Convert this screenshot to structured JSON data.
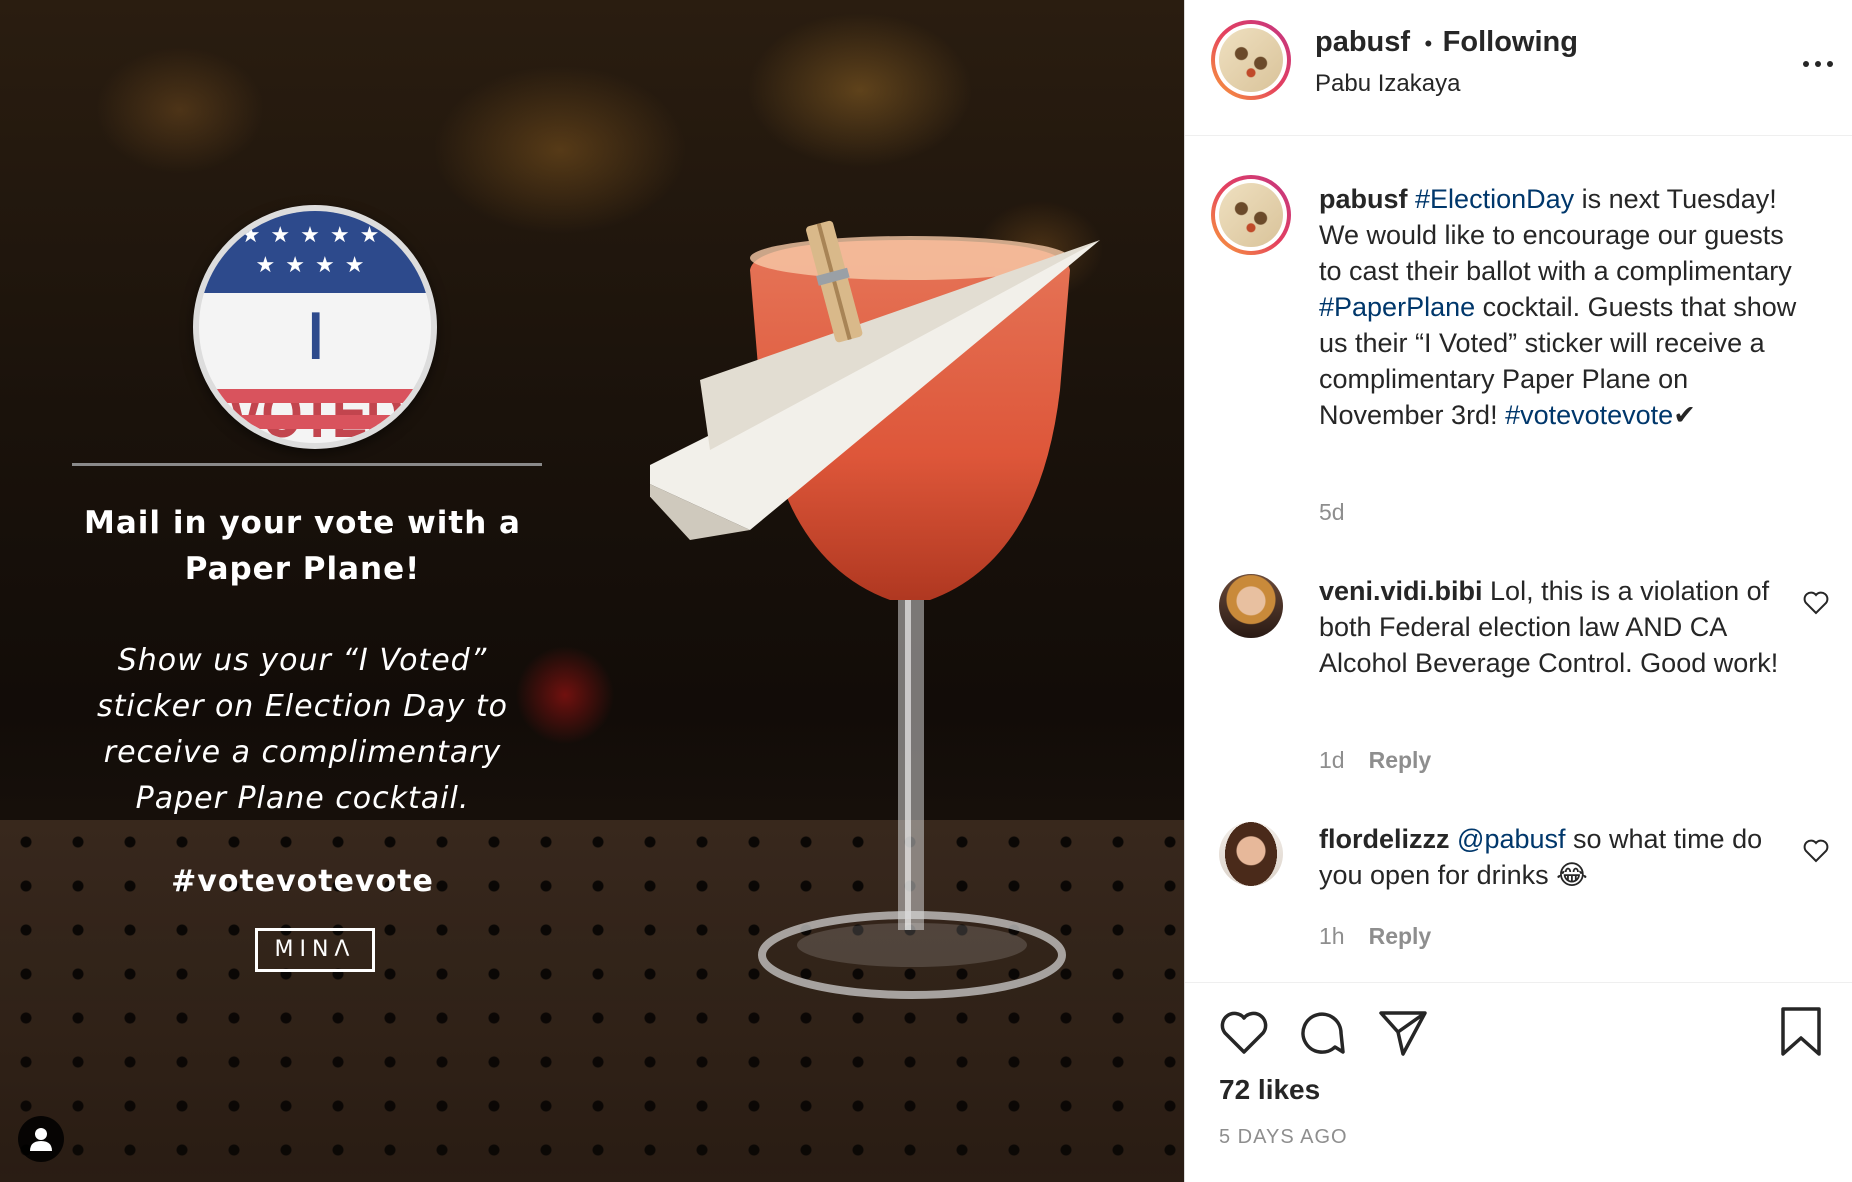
{
  "post_image": {
    "sticker_text": "I VOTED",
    "headline": "Mail in your vote with a Paper Plane!",
    "body": "Show us your “I Voted” sticker on Election Day to receive a complimentary Paper Plane cocktail.",
    "hashtag": "#votevotevote",
    "logo": "MINΛ"
  },
  "header": {
    "username": "pabusf",
    "separator": "•",
    "following_label": "Following",
    "location": "Pabu Izakaya"
  },
  "caption": {
    "username": "pabusf",
    "tag1": "#ElectionDay",
    "text1": " is next Tuesday! We would like to encourage our guests to cast their ballot with a complimentary ",
    "tag2": "#PaperPlane",
    "text2": " cocktail. Guests that show us their “I Voted” sticker will receive a complimentary Paper Plane on November 3rd! ",
    "tag3": "#votevotevote",
    "emoji": "✔",
    "age": "5d"
  },
  "comments": [
    {
      "username": "veni.vidi.bibi",
      "text": " Lol, this is a violation of both Federal election law AND CA Alcohol Beverage Control. Good work!",
      "age": "1d",
      "reply_label": "Reply"
    },
    {
      "username": "flordelizzz",
      "mention": "@pabusf",
      "text": " so what time do you open for drinks ",
      "emoji": "😂",
      "age": "1h",
      "reply_label": "Reply"
    }
  ],
  "footer": {
    "likes": "72 likes",
    "posted": "5 DAYS AGO"
  },
  "colors": {
    "link": "#00376b",
    "muted": "#8e8e8e",
    "text": "#262626"
  },
  "icons": [
    "heart-icon",
    "comment-icon",
    "share-icon",
    "bookmark-icon",
    "more-options-icon",
    "user-tag-icon"
  ]
}
